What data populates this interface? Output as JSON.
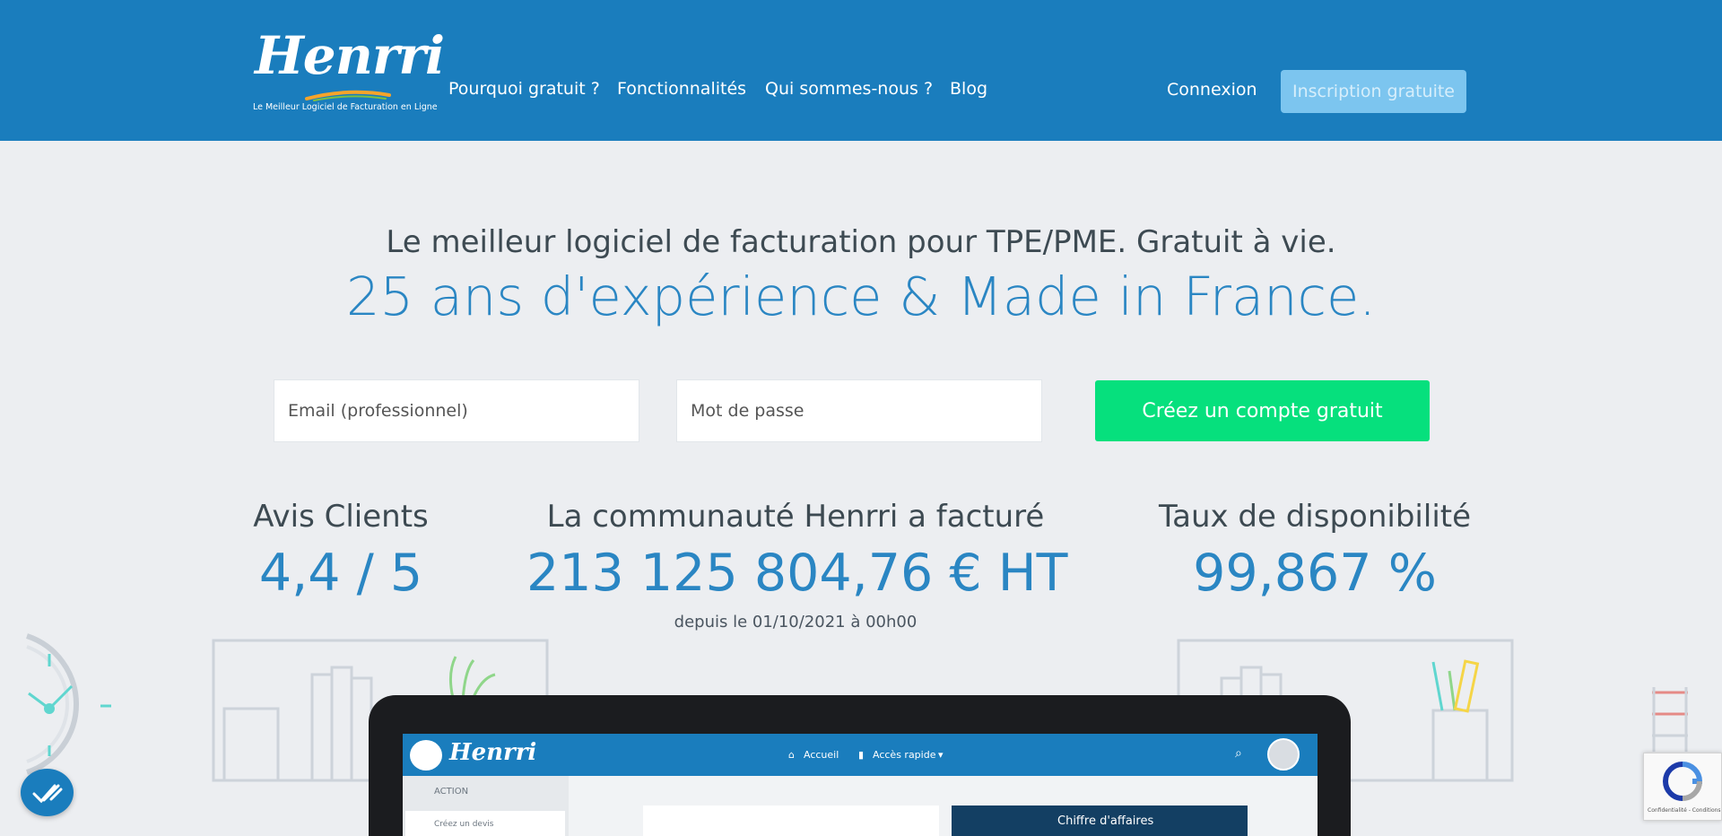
{
  "header": {
    "logo_text": "Henrri",
    "logo_tagline": "Le Meilleur Logiciel de Facturation en Ligne",
    "nav": [
      "Pourquoi gratuit ?",
      "Fonctionnalités",
      "Qui sommes-nous ?",
      "Blog"
    ],
    "login_label": "Connexion",
    "signup_label": "Inscription gratuite"
  },
  "hero": {
    "line1": "Le meilleur logiciel de facturation pour TPE/PME. Gratuit à vie.",
    "line2": "25 ans d'expérience & Made in France."
  },
  "signup_form": {
    "email_placeholder": "Email (professionnel)",
    "password_placeholder": "Mot de passe",
    "submit_label": "Créez un compte gratuit"
  },
  "stats": {
    "reviews_label": "Avis Clients",
    "reviews_value": "4,4 / 5",
    "billed_label": "La communauté Henrri a facturé",
    "billed_value": "213 125 804,76 € HT",
    "billed_since": "depuis le 01/10/2021 à 00h00",
    "availability_label": "Taux de disponibilité",
    "availability_value": "99,867 %"
  },
  "app_preview": {
    "logo_text": "Henrri",
    "nav_home": "Accueil",
    "nav_quick": "Accès rapide",
    "sidebar_section": "ACTION",
    "sidebar_item": "Créez un devis",
    "card_title": "Chiffre d'affaires"
  },
  "recaptcha": {
    "footer": "Confidentialité - Conditions"
  },
  "colors": {
    "header_blue": "#1a7dbd",
    "accent_blue": "#2a86c3",
    "cta_green": "#06e07d",
    "signup_button": "#7cc5ef",
    "background": "#eceef1"
  }
}
